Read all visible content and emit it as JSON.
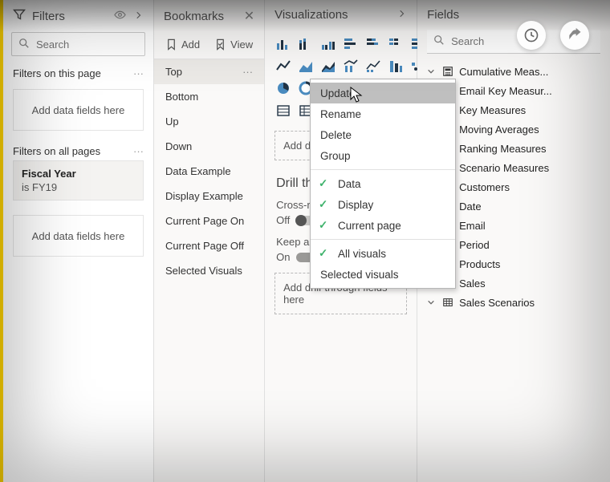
{
  "filters": {
    "title": "Filters",
    "searchPlaceholder": "Search",
    "thisPageLabel": "Filters on this page",
    "allPagesLabel": "Filters on all pages",
    "dropHint": "Add data fields here",
    "card": {
      "name": "Fiscal Year",
      "value": "is FY19"
    }
  },
  "bookmarks": {
    "title": "Bookmarks",
    "addLabel": "Add",
    "viewLabel": "View",
    "items": [
      "Top",
      "Bottom",
      "Up",
      "Down",
      "Data Example",
      "Display Example",
      "Current Page On",
      "Current Page Off",
      "Selected Visuals"
    ],
    "selectedIndex": 0
  },
  "viz": {
    "title": "Visualizations",
    "dropHint": "Add data fields here",
    "drillTitle": "Drill through",
    "crossReportLabel": "Cross-report",
    "crossReportValue": "Off",
    "keepFiltersLabel": "Keep all filters",
    "keepFiltersValue": "On",
    "drillDropHint": "Add drill-through fields here"
  },
  "fields": {
    "title": "Fields",
    "searchPlaceholder": "Search",
    "items": [
      {
        "label": "Cumulative Meas...",
        "kind": "calc"
      },
      {
        "label": "Email Key Measur...",
        "kind": "calc"
      },
      {
        "label": "Key Measures",
        "kind": "calc"
      },
      {
        "label": "Moving Averages",
        "kind": "calc"
      },
      {
        "label": "Ranking Measures",
        "kind": "calc"
      },
      {
        "label": "Scenario Measures",
        "kind": "calc"
      },
      {
        "label": "Customers",
        "kind": "table"
      },
      {
        "label": "Date",
        "kind": "table"
      },
      {
        "label": "Email",
        "kind": "table"
      },
      {
        "label": "Period",
        "kind": "table"
      },
      {
        "label": "Products",
        "kind": "table"
      },
      {
        "label": "Sales",
        "kind": "table"
      },
      {
        "label": "Sales Scenarios",
        "kind": "table"
      }
    ]
  },
  "contextMenu": {
    "items": [
      {
        "label": "Update",
        "hilite": true
      },
      {
        "label": "Rename"
      },
      {
        "label": "Delete"
      },
      {
        "label": "Group"
      },
      {
        "sep": true
      },
      {
        "label": "Data",
        "checked": true
      },
      {
        "label": "Display",
        "checked": true
      },
      {
        "label": "Current page",
        "checked": true
      },
      {
        "sep": true
      },
      {
        "label": "All visuals",
        "checked": true
      },
      {
        "label": "Selected visuals"
      }
    ]
  }
}
